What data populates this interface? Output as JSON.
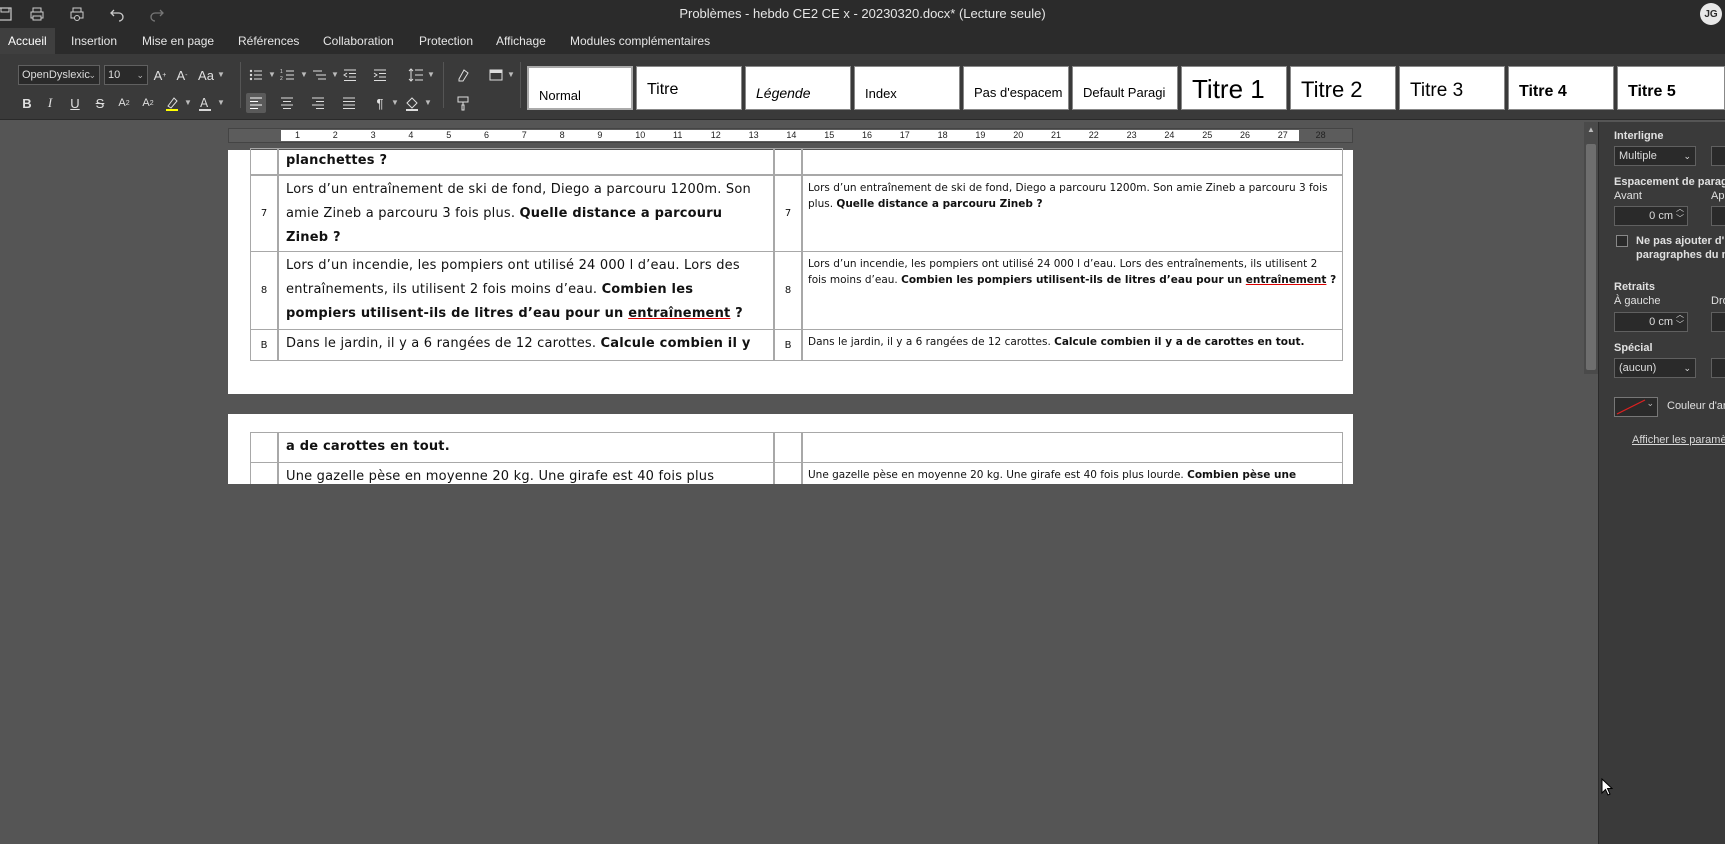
{
  "window": {
    "title": "Problèmes - hebdo CE2 CE x - 20230320.docx* (Lecture seule)",
    "user_initials": "JG"
  },
  "menu": {
    "tabs": [
      "Accueil",
      "Insertion",
      "Mise en page",
      "Références",
      "Collaboration",
      "Protection",
      "Affichage",
      "Modules complémentaires"
    ]
  },
  "toolbar": {
    "font_name": "OpenDyslexic",
    "font_size": "10",
    "styles": [
      "Normal",
      "Titre",
      "Légende",
      "Index",
      "Pas d'espacem",
      "Default Paragi",
      "Titre 1",
      "Titre 2",
      "Titre 3",
      "Titre 4",
      "Titre 5"
    ]
  },
  "ruler": {
    "numbers": [
      "1",
      "2",
      "3",
      "4",
      "5",
      "6",
      "7",
      "8",
      "9",
      "10",
      "11",
      "12",
      "13",
      "14",
      "15",
      "16",
      "17",
      "18",
      "19",
      "20",
      "21",
      "22",
      "23",
      "24",
      "25",
      "26",
      "27",
      "28"
    ]
  },
  "document": {
    "page1": {
      "row0_left": "planchettes ?",
      "rows": [
        {
          "num": "7",
          "left_text": "Lors d’un entraînement de ski de fond, Diego a parcouru 1200m. Son amie Zineb a parcouru 3 fois plus. ",
          "left_bold": "Quelle distance a parcouru Zineb ?",
          "right_text": "Lors d’un entraînement de ski de fond, Diego a parcouru 1200m. Son amie Zineb a parcouru 3 fois plus. ",
          "right_bold": "Quelle distance a parcouru Zineb ?"
        },
        {
          "num": "8",
          "left_text": "Lors d’un incendie, les pompiers ont utilisé 24 000 l d’eau. Lors des entraînements, ils utilisent 2 fois moins d’eau. ",
          "left_bold_1": "Combien les pompiers utilisent-ils de litres d’eau pour un ",
          "left_bold_u": "entraînement",
          "left_bold_2": " ?",
          "right_text": "Lors d’un incendie, les pompiers ont utilisé 24 000 l d’eau. Lors des entraînements, ils utilisent 2 fois moins d’eau. ",
          "right_bold_1": "Combien les pompiers utilisent-ils de litres d’eau pour un ",
          "right_bold_u": "entraînement",
          "right_bold_2": " ?"
        },
        {
          "num": "B",
          "left_text": "Dans le jardin, il y a 6 rangées de 12 carottes. ",
          "left_bold": "Calcule combien il y",
          "right_text": "Dans le jardin, il y a 6 rangées de 12 carottes. ",
          "right_bold": "Calcule combien il y a de carottes en tout."
        }
      ]
    },
    "page2": {
      "row0_left": "a de carottes en tout.",
      "row1_left": "Une gazelle pèse en moyenne 20 kg. Une girafe est 40 fois plus",
      "row1_right_text": "Une gazelle pèse en moyenne 20 kg. Une girafe est 40 fois plus lourde. ",
      "row1_right_bold": "Combien pèse une"
    }
  },
  "panel": {
    "interligne_label": "Interligne",
    "interligne_value": "Multiple",
    "espacement_label": "Espacement de parag",
    "avant_label": "Avant",
    "apres_label": "Apr",
    "avant_value": "0 cm",
    "no_space_label_1": "Ne pas ajouter d'in",
    "no_space_label_2": "paragraphes du m",
    "retraits_label": "Retraits",
    "gauche_label": "À gauche",
    "droite_label": "Dro",
    "gauche_value": "0 cm",
    "special_label": "Spécial",
    "special_value": "(aucun)",
    "couleur_label": "Couleur d'ar",
    "advanced_link": "Afficher les paramè"
  }
}
